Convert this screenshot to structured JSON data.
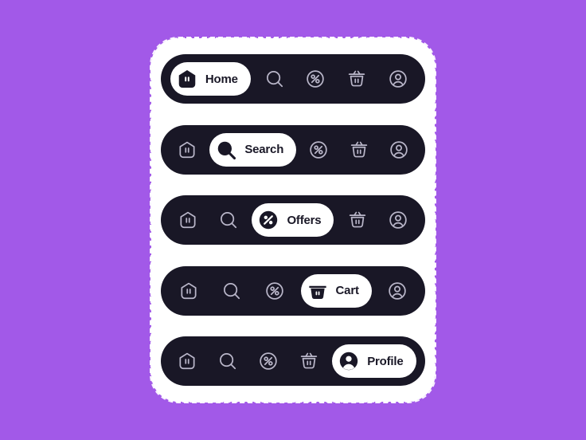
{
  "page": {
    "background_color": "#a259e8",
    "card_color": "#ffffff",
    "bar_color": "#191726",
    "active_pill_color": "#ffffff",
    "active_label_color": "#191726",
    "inactive_icon_color": "#b9b6c9"
  },
  "icons": {
    "home": "home-icon",
    "search": "search-icon",
    "offers": "percent-circle-icon",
    "cart": "basket-icon",
    "profile": "person-circle-icon"
  },
  "labels": {
    "home": "Home",
    "search": "Search",
    "offers": "Offers",
    "cart": "Cart",
    "profile": "Profile"
  },
  "bars": [
    {
      "name": "navbar-home-active",
      "active_index": 0,
      "items": [
        {
          "key": "home",
          "label": "Home",
          "icon": "home-icon",
          "active": true
        },
        {
          "key": "search",
          "label": "Search",
          "icon": "search-icon",
          "active": false
        },
        {
          "key": "offers",
          "label": "Offers",
          "icon": "percent-circle-icon",
          "active": false
        },
        {
          "key": "cart",
          "label": "Cart",
          "icon": "basket-icon",
          "active": false
        },
        {
          "key": "profile",
          "label": "Profile",
          "icon": "person-circle-icon",
          "active": false
        }
      ]
    },
    {
      "name": "navbar-search-active",
      "active_index": 1,
      "items": [
        {
          "key": "home",
          "label": "Home",
          "icon": "home-icon",
          "active": false
        },
        {
          "key": "search",
          "label": "Search",
          "icon": "search-icon",
          "active": true
        },
        {
          "key": "offers",
          "label": "Offers",
          "icon": "percent-circle-icon",
          "active": false
        },
        {
          "key": "cart",
          "label": "Cart",
          "icon": "basket-icon",
          "active": false
        },
        {
          "key": "profile",
          "label": "Profile",
          "icon": "person-circle-icon",
          "active": false
        }
      ]
    },
    {
      "name": "navbar-offers-active",
      "active_index": 2,
      "items": [
        {
          "key": "home",
          "label": "Home",
          "icon": "home-icon",
          "active": false
        },
        {
          "key": "search",
          "label": "Search",
          "icon": "search-icon",
          "active": false
        },
        {
          "key": "offers",
          "label": "Offers",
          "icon": "percent-circle-icon",
          "active": true
        },
        {
          "key": "cart",
          "label": "Cart",
          "icon": "basket-icon",
          "active": false
        },
        {
          "key": "profile",
          "label": "Profile",
          "icon": "person-circle-icon",
          "active": false
        }
      ]
    },
    {
      "name": "navbar-cart-active",
      "active_index": 3,
      "items": [
        {
          "key": "home",
          "label": "Home",
          "icon": "home-icon",
          "active": false
        },
        {
          "key": "search",
          "label": "Search",
          "icon": "search-icon",
          "active": false
        },
        {
          "key": "offers",
          "label": "Offers",
          "icon": "percent-circle-icon",
          "active": false
        },
        {
          "key": "cart",
          "label": "Cart",
          "icon": "basket-icon",
          "active": true
        },
        {
          "key": "profile",
          "label": "Profile",
          "icon": "person-circle-icon",
          "active": false
        }
      ]
    },
    {
      "name": "navbar-profile-active",
      "active_index": 4,
      "items": [
        {
          "key": "home",
          "label": "Home",
          "icon": "home-icon",
          "active": false
        },
        {
          "key": "search",
          "label": "Search",
          "icon": "search-icon",
          "active": false
        },
        {
          "key": "offers",
          "label": "Offers",
          "icon": "percent-circle-icon",
          "active": false
        },
        {
          "key": "cart",
          "label": "Cart",
          "icon": "basket-icon",
          "active": false
        },
        {
          "key": "profile",
          "label": "Profile",
          "icon": "person-circle-icon",
          "active": true
        }
      ]
    }
  ]
}
